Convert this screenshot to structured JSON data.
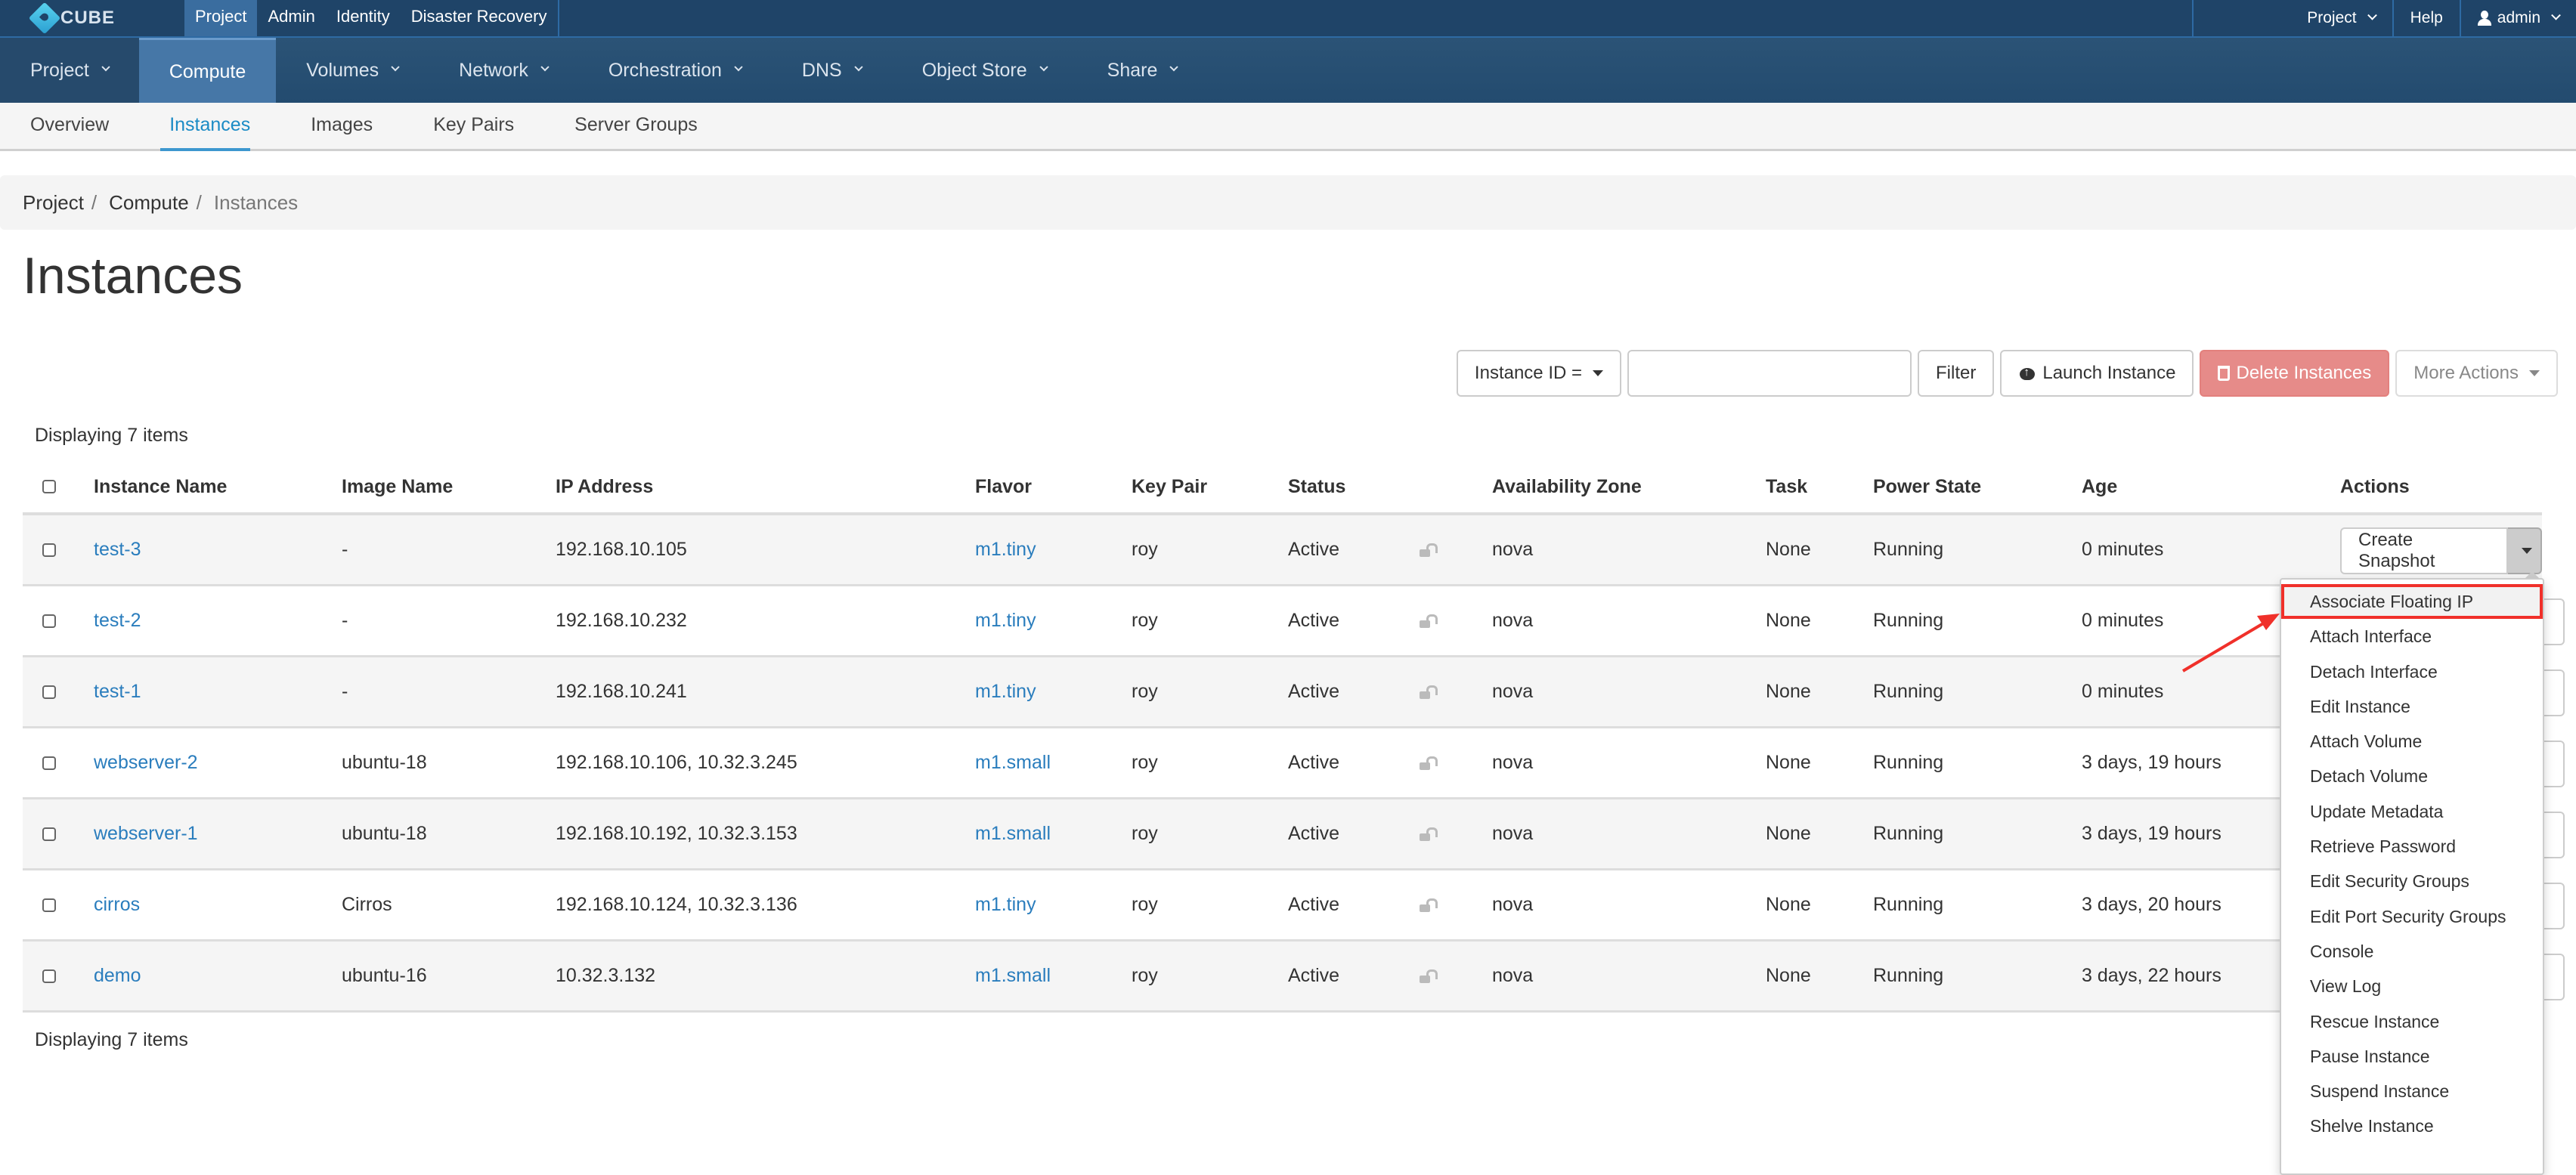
{
  "brand": {
    "name": "CUBE"
  },
  "dashboards": [
    {
      "label": "Project",
      "active": true
    },
    {
      "label": "Admin"
    },
    {
      "label": "Identity"
    },
    {
      "label": "Disaster Recovery"
    }
  ],
  "top_right": {
    "project_label": "Project",
    "help_label": "Help",
    "user_label": "admin"
  },
  "main_nav": [
    {
      "label": "Project",
      "has_menu": true
    },
    {
      "label": "Compute",
      "active": true
    },
    {
      "label": "Volumes",
      "has_menu": true
    },
    {
      "label": "Network",
      "has_menu": true
    },
    {
      "label": "Orchestration",
      "has_menu": true
    },
    {
      "label": "DNS",
      "has_menu": true
    },
    {
      "label": "Object Store",
      "has_menu": true
    },
    {
      "label": "Share",
      "has_menu": true
    }
  ],
  "sub_nav": [
    {
      "label": "Overview"
    },
    {
      "label": "Instances",
      "active": true
    },
    {
      "label": "Images"
    },
    {
      "label": "Key Pairs"
    },
    {
      "label": "Server Groups"
    }
  ],
  "breadcrumb": [
    "Project",
    "Compute",
    "Instances"
  ],
  "page_title": "Instances",
  "toolbar": {
    "filter_field": "Instance ID =",
    "filter_value": "",
    "filter_button": "Filter",
    "launch_button": "Launch Instance",
    "delete_button": "Delete Instances",
    "more_button": "More Actions"
  },
  "display_count_top": "Displaying 7 items",
  "display_count_bottom": "Displaying 7 items",
  "table": {
    "columns": [
      "Instance Name",
      "Image Name",
      "IP Address",
      "Flavor",
      "Key Pair",
      "Status",
      "Availability Zone",
      "Task",
      "Power State",
      "Age",
      "Actions"
    ],
    "rows": [
      {
        "name": "test-3",
        "image": "-",
        "ip": "192.168.10.105",
        "flavor": "m1.tiny",
        "key_pair": "roy",
        "status": "Active",
        "zone": "nova",
        "task": "None",
        "power": "Running",
        "age": "0 minutes"
      },
      {
        "name": "test-2",
        "image": "-",
        "ip": "192.168.10.232",
        "flavor": "m1.tiny",
        "key_pair": "roy",
        "status": "Active",
        "zone": "nova",
        "task": "None",
        "power": "Running",
        "age": "0 minutes"
      },
      {
        "name": "test-1",
        "image": "-",
        "ip": "192.168.10.241",
        "flavor": "m1.tiny",
        "key_pair": "roy",
        "status": "Active",
        "zone": "nova",
        "task": "None",
        "power": "Running",
        "age": "0 minutes"
      },
      {
        "name": "webserver-2",
        "image": "ubuntu-18",
        "ip": "192.168.10.106, 10.32.3.245",
        "flavor": "m1.small",
        "key_pair": "roy",
        "status": "Active",
        "zone": "nova",
        "task": "None",
        "power": "Running",
        "age": "3 days, 19 hours"
      },
      {
        "name": "webserver-1",
        "image": "ubuntu-18",
        "ip": "192.168.10.192, 10.32.3.153",
        "flavor": "m1.small",
        "key_pair": "roy",
        "status": "Active",
        "zone": "nova",
        "task": "None",
        "power": "Running",
        "age": "3 days, 19 hours"
      },
      {
        "name": "cirros",
        "image": "Cirros",
        "ip": "192.168.10.124, 10.32.3.136",
        "flavor": "m1.tiny",
        "key_pair": "roy",
        "status": "Active",
        "zone": "nova",
        "task": "None",
        "power": "Running",
        "age": "3 days, 20 hours"
      },
      {
        "name": "demo",
        "image": "ubuntu-16",
        "ip": "10.32.3.132",
        "flavor": "m1.small",
        "key_pair": "roy",
        "status": "Active",
        "zone": "nova",
        "task": "None",
        "power": "Running",
        "age": "3 days, 22 hours"
      }
    ],
    "row_action": "Create Snapshot"
  },
  "action_menu": {
    "items": [
      "Associate Floating IP",
      "Attach Interface",
      "Detach Interface",
      "Edit Instance",
      "Attach Volume",
      "Detach Volume",
      "Update Metadata",
      "Retrieve Password",
      "Edit Security Groups",
      "Edit Port Security Groups",
      "Console",
      "View Log",
      "Rescue Instance",
      "Pause Instance",
      "Suspend Instance",
      "Shelve Instance"
    ],
    "highlighted": "Associate Floating IP"
  },
  "colors": {
    "topbar": "#1f4468",
    "nav": "#2b5376",
    "nav_active": "#4677a7",
    "link": "#2a7dbd",
    "danger": "#e68b89",
    "annotation": "#f0302a"
  }
}
